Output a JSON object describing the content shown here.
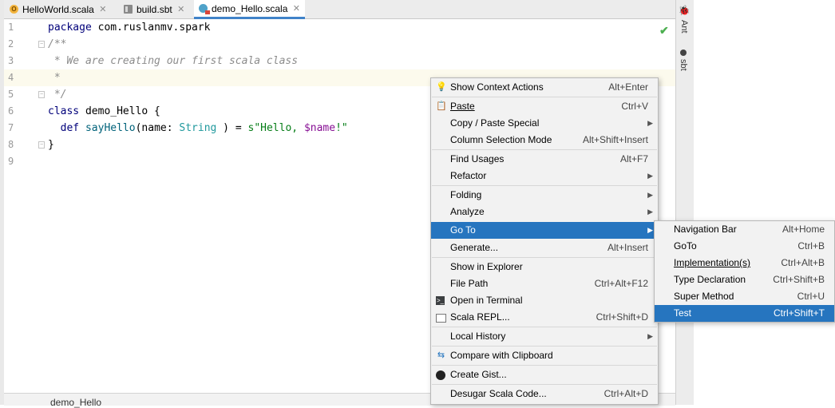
{
  "tabs": [
    {
      "label": "HelloWorld.scala",
      "icon": "scala-object-icon",
      "active": false
    },
    {
      "label": "build.sbt",
      "icon": "sbt-file-icon",
      "active": false
    },
    {
      "label": "demo_Hello.scala",
      "icon": "scala-class-icon",
      "active": true
    }
  ],
  "editor": {
    "line_numbers": [
      "1",
      "2",
      "3",
      "4",
      "5",
      "6",
      "7",
      "8",
      "9"
    ],
    "lines": {
      "l1_kw": "package",
      "l1_rest": " com.ruslanmv.spark",
      "l2": "/**",
      "l3": " * We are creating our first scala class",
      "l4": " *",
      "l5": " */",
      "l6_kw": "class",
      "l6_rest": " demo_Hello {",
      "l7_indent": "  ",
      "l7_kw": "def",
      "l7_fn": " sayHello",
      "l7_a": "(name: ",
      "l7_ty": "String",
      "l7_b": " ) = ",
      "l7_s1": "s\"Hello, ",
      "l7_var": "$name",
      "l7_s2": "!\"",
      "l8": "}"
    }
  },
  "breadcrumb": "demo_Hello",
  "right_tools": {
    "ant": "Ant",
    "sbt": "sbt"
  },
  "context_menu": {
    "show_context_actions": {
      "label": "Show Context Actions",
      "shortcut": "Alt+Enter"
    },
    "paste": {
      "label": "Paste",
      "shortcut": "Ctrl+V"
    },
    "copy_paste_special": {
      "label": "Copy / Paste Special"
    },
    "column_selection_mode": {
      "label": "Column Selection Mode",
      "shortcut": "Alt+Shift+Insert"
    },
    "find_usages": {
      "label": "Find Usages",
      "shortcut": "Alt+F7"
    },
    "refactor": {
      "label": "Refactor"
    },
    "folding": {
      "label": "Folding"
    },
    "analyze": {
      "label": "Analyze"
    },
    "go_to": {
      "label": "Go To"
    },
    "generate": {
      "label": "Generate...",
      "shortcut": "Alt+Insert"
    },
    "show_in_explorer": {
      "label": "Show in Explorer"
    },
    "file_path": {
      "label": "File Path",
      "shortcut": "Ctrl+Alt+F12"
    },
    "open_in_terminal": {
      "label": "Open in Terminal"
    },
    "scala_repl": {
      "label": "Scala REPL...",
      "shortcut": "Ctrl+Shift+D"
    },
    "local_history": {
      "label": "Local History"
    },
    "compare_clipboard": {
      "label": "Compare with Clipboard"
    },
    "create_gist": {
      "label": "Create Gist..."
    },
    "desugar": {
      "label": "Desugar Scala Code...",
      "shortcut": "Ctrl+Alt+D"
    }
  },
  "goto_submenu": {
    "navigation_bar": {
      "label": "Navigation Bar",
      "shortcut": "Alt+Home"
    },
    "goto": {
      "label": "GoTo",
      "shortcut": "Ctrl+B"
    },
    "implementations": {
      "label": "Implementation(s)",
      "shortcut": "Ctrl+Alt+B"
    },
    "type_declaration": {
      "label": "Type Declaration",
      "shortcut": "Ctrl+Shift+B"
    },
    "super_method": {
      "label": "Super Method",
      "shortcut": "Ctrl+U"
    },
    "test": {
      "label": "Test",
      "shortcut": "Ctrl+Shift+T"
    }
  },
  "colors": {
    "selection": "#2675bf",
    "menu_bg": "#f2f2f2",
    "current_line": "#fcfaed"
  }
}
